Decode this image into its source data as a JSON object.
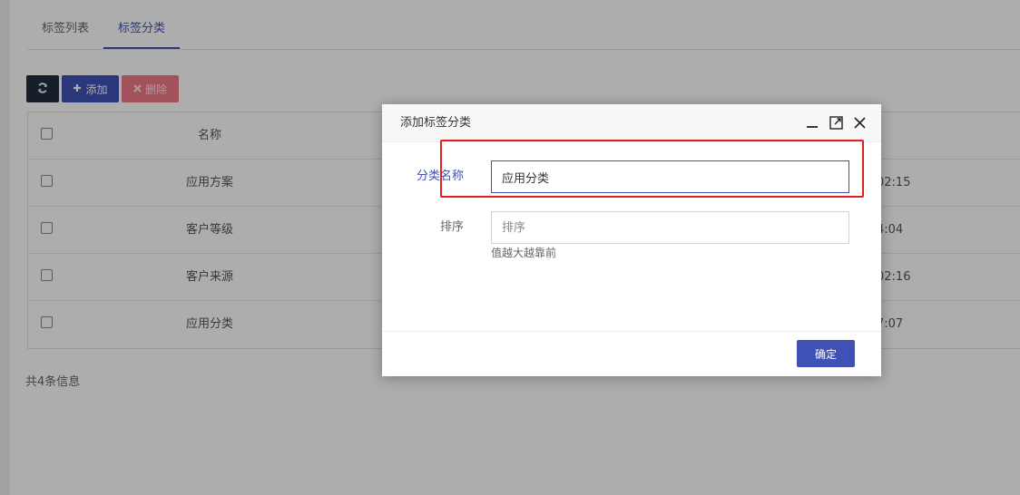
{
  "tabs": [
    {
      "label": "标签列表",
      "active": false
    },
    {
      "label": "标签分类",
      "active": true
    }
  ],
  "toolbar": {
    "refresh_icon": "refresh-icon",
    "add_label": "添加",
    "delete_label": "删除"
  },
  "table": {
    "header": {
      "name": "名称"
    },
    "rows": [
      {
        "name": "应用方案",
        "time_fragment": "02:15"
      },
      {
        "name": "客户等级",
        "time_fragment": "4:04"
      },
      {
        "name": "客户来源",
        "time_fragment": "02:16"
      },
      {
        "name": "应用分类",
        "time_fragment": "7:07"
      }
    ]
  },
  "footer": {
    "count_text": "共4条信息"
  },
  "dialog": {
    "title": "添加标签分类",
    "fields": {
      "category_name": {
        "label": "分类名称",
        "value": "应用分类"
      },
      "sort": {
        "label": "排序",
        "placeholder": "排序",
        "help": "值越大越靠前"
      }
    },
    "confirm_label": "确定"
  },
  "colors": {
    "accent": "#3f51b5",
    "danger": "#ef7a86",
    "dark": "#1f2d3d",
    "highlight": "#e02020"
  }
}
